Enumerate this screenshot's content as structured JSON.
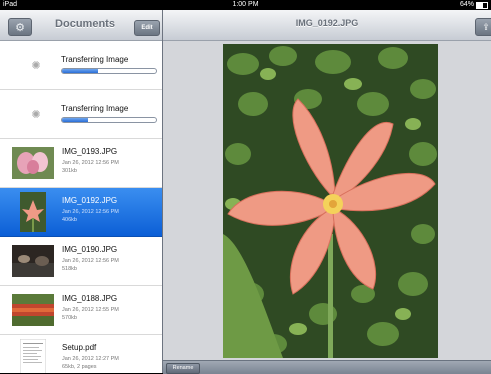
{
  "status_bar": {
    "device": "iPad",
    "time": "1:00 PM",
    "battery": "64%"
  },
  "sidebar": {
    "title": "Documents",
    "edit_label": "Edit",
    "transfers": [
      {
        "label": "Transferring Image",
        "progress": 0.38
      },
      {
        "label": "Transferring Image",
        "progress": 0.28
      }
    ],
    "files": [
      {
        "name": "IMG_0193.JPG",
        "date": "Jan 26, 2012 12:56 PM",
        "size": "301kb",
        "selected": false
      },
      {
        "name": "IMG_0192.JPG",
        "date": "Jan 26, 2012 12:56 PM",
        "size": "406kb",
        "selected": true
      },
      {
        "name": "IMG_0190.JPG",
        "date": "Jan 26, 2012 12:56 PM",
        "size": "518kb",
        "selected": false
      },
      {
        "name": "IMG_0188.JPG",
        "date": "Jan 26, 2012 12:55 PM",
        "size": "570kb",
        "selected": false
      },
      {
        "name": "Setup.pdf",
        "date": "Jan 26, 2012 12:27 PM",
        "size": "65kb, 2 pages",
        "selected": false
      }
    ]
  },
  "main": {
    "title": "IMG_0192.JPG",
    "rename_label": "Rename"
  },
  "colors": {
    "selection": "#1a6fe0",
    "nav_bar": "#c7ccd4"
  }
}
